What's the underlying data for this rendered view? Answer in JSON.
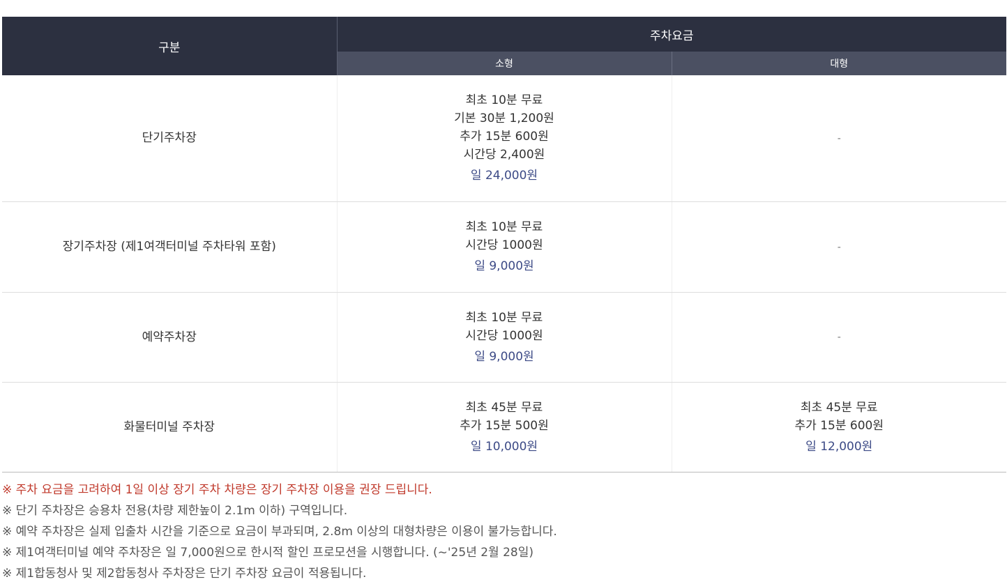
{
  "table": {
    "header": {
      "category": "구분",
      "fee_group": "주차요금",
      "small": "소형",
      "large": "대형"
    },
    "rows": [
      {
        "category": "단기주차장",
        "small_lines": [
          "최초 10분 무료",
          "기본 30분 1,200원",
          "추가 15분 600원",
          "시간당 2,400원"
        ],
        "small_day": "일 24,000원",
        "large_lines": [],
        "large_day": "",
        "large_empty": "-"
      },
      {
        "category": "장기주차장 (제1여객터미널 주차타워 포함)",
        "small_lines": [
          "최초 10분 무료",
          "시간당 1000원"
        ],
        "small_day": "일 9,000원",
        "large_lines": [],
        "large_day": "",
        "large_empty": "-"
      },
      {
        "category": "예약주차장",
        "small_lines": [
          "최초 10분 무료",
          "시간당 1000원"
        ],
        "small_day": "일 9,000원",
        "large_lines": [],
        "large_day": "",
        "large_empty": "-"
      },
      {
        "category": "화물터미널 주차장",
        "small_lines": [
          "최초 45분 무료",
          "추가 15분 500원"
        ],
        "small_day": "일 10,000원",
        "large_lines": [
          "최초 45분 무료",
          "추가 15분 600원"
        ],
        "large_day": "일 12,000원",
        "large_empty": ""
      }
    ]
  },
  "notes": [
    {
      "text": "※ 주차 요금을 고려하여 1일 이상 장기 주차 차량은 장기 주차장 이용을 권장 드립니다.",
      "highlight": true
    },
    {
      "text": "※ 단기 주차장은 승용차 전용(차량 제한높이 2.1m 이하) 구역입니다.",
      "highlight": false
    },
    {
      "text": "※ 예약 주차장은 실제 입출차 시간을 기준으로 요금이 부과되며, 2.8m 이상의 대형차량은 이용이 불가능합니다.",
      "highlight": false
    },
    {
      "text": "※ 제1여객터미널 예약 주차장은 일 7,000원으로 한시적 할인 프로모션을 시행합니다. (~'25년 2월 28일)",
      "highlight": false
    },
    {
      "text": "※ 제1합동청사 및 제2합동청사 주차장은 단기 주차장 요금이 적용됩니다.",
      "highlight": false
    }
  ],
  "colors": {
    "header_dark": "#2c3040",
    "header_sub": "#4b5062",
    "day_rate": "#3c4a86",
    "warning": "#c0392b"
  }
}
